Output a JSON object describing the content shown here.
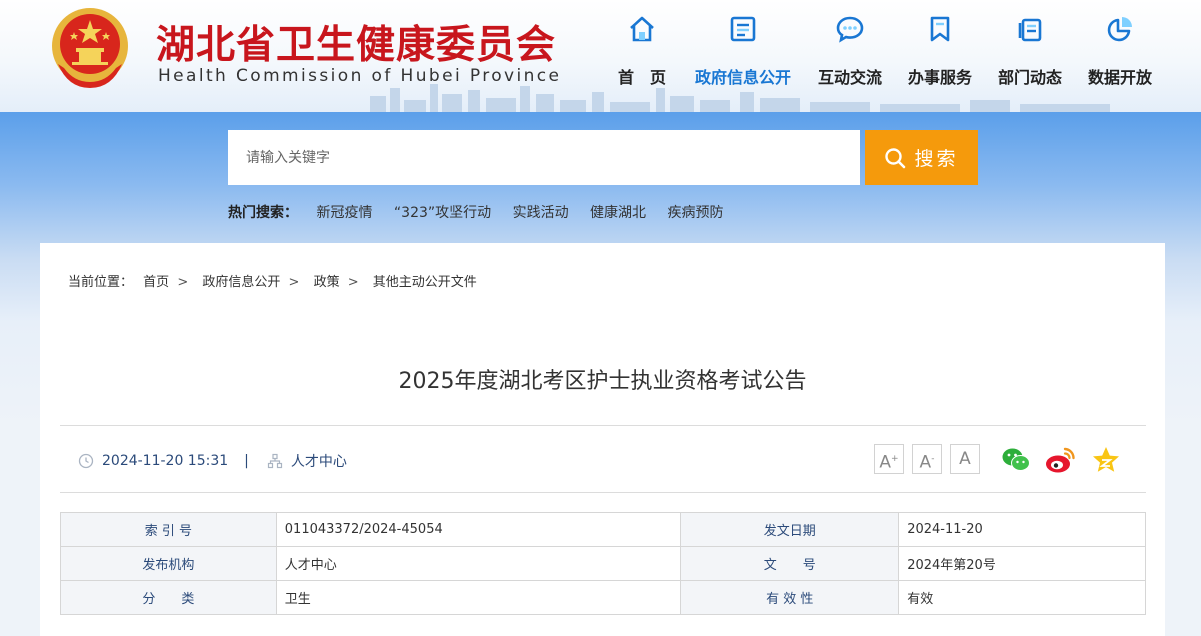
{
  "header": {
    "site_name": "湖北省卫生健康委员会",
    "site_name_en": "Health Commission of Hubei Province",
    "brand_color": "#c8161d"
  },
  "nav": {
    "items": [
      {
        "label": "首　页",
        "icon": "home-icon"
      },
      {
        "label": "政府信息公开",
        "icon": "document-list-icon",
        "active": true
      },
      {
        "label": "互动交流",
        "icon": "chat-bubble-icon"
      },
      {
        "label": "办事服务",
        "icon": "bookmark-icon"
      },
      {
        "label": "部门动态",
        "icon": "files-icon"
      },
      {
        "label": "数据开放",
        "icon": "pie-chart-icon"
      }
    ],
    "active_color": "#1977d3"
  },
  "search": {
    "placeholder": "请输入关键字",
    "button_label": "搜索",
    "button_color": "#f59a0c",
    "hot_label": "热门搜索：",
    "hot_terms": [
      "新冠疫情",
      "“323”攻坚行动",
      "实践活动",
      "健康湖北",
      "疾病预防"
    ]
  },
  "breadcrumb": {
    "prefix": "当前位置：",
    "items": [
      "首页",
      "政府信息公开",
      "政策",
      "其他主动公开文件"
    ],
    "separator": ">"
  },
  "article": {
    "title": "2025年度湖北考区护士执业资格考试公告",
    "datetime": "2024-11-20 15:31",
    "divider": "|",
    "source": "人才中心",
    "font_sizes": [
      "A",
      "A",
      "A"
    ]
  },
  "share": [
    "wechat-icon",
    "weibo-icon",
    "favorite-star-icon"
  ],
  "info_table": {
    "rows": [
      {
        "k1": "索 引 号",
        "v1": "011043372/2024-45054",
        "k2": "发文日期",
        "v2": "2024-11-20"
      },
      {
        "k1": "发布机构",
        "v1": "人才中心",
        "k2": "文　　号",
        "v2": "2024年第20号"
      },
      {
        "k1": "分　　类",
        "v1": "卫生",
        "k2": "有 效 性",
        "v2": "有效"
      }
    ]
  }
}
